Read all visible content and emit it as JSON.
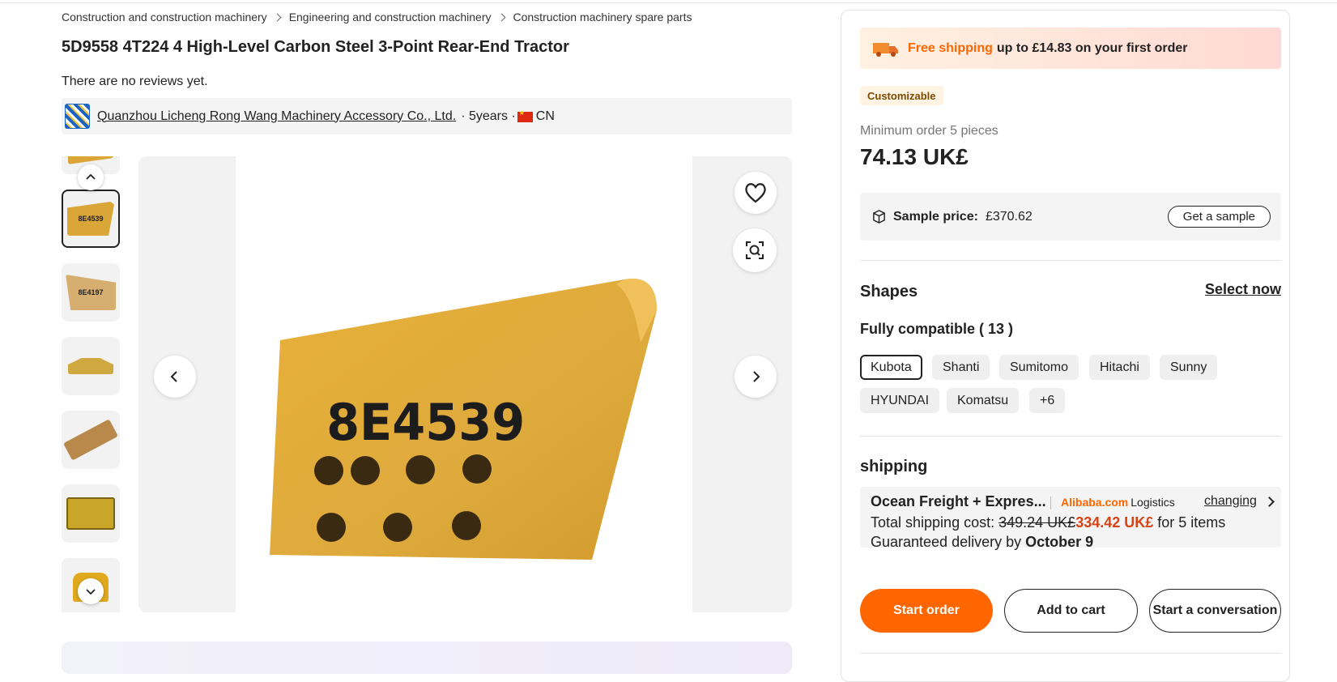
{
  "breadcrumb": [
    "Construction and construction machinery",
    "Engineering and construction machinery",
    "Construction machinery spare parts"
  ],
  "product": {
    "title": "5D9558 4T224 4 High-Level Carbon Steel 3-Point Rear-End Tractor",
    "reviews": "There are no reviews yet."
  },
  "supplier": {
    "name": "Quanzhou Licheng Rong Wang Machinery Accessory Co., Ltd.",
    "years": "· 5years ·",
    "country": "CN"
  },
  "gallery": {
    "main_image_code": "8E4539",
    "thumbnail_codes": [
      "8E4539",
      "8E4197"
    ]
  },
  "promo": {
    "highlight": "Free shipping",
    "rest": "up to £14.83 on your first order"
  },
  "badge": "Customizable",
  "pricing": {
    "min_order": "Minimum order 5 pieces",
    "price": "74.13 UK£",
    "sample_label": "Sample price:",
    "sample_value": "£370.62",
    "sample_button": "Get a sample"
  },
  "shapes": {
    "title": "Shapes",
    "select_now": "Select now",
    "compat": "Fully compatible ( 13 )",
    "chips": [
      "Kubota",
      "Shanti",
      "Sumitomo",
      "Hitachi",
      "Sunny",
      "HYUNDAI",
      "Komatsu",
      "+6"
    ],
    "selected": "Kubota"
  },
  "shipping": {
    "title": "shipping",
    "method": "Ocean Freight + Expres...",
    "logistics_brand": "Alibaba.com",
    "logistics_word": "Logistics",
    "change": "changing",
    "cost_prefix": "Total shipping cost:",
    "cost_old": "349.24 UK£",
    "cost_new": "334.42 UK£",
    "cost_suffix": "for 5 items",
    "delivery_prefix": "Guaranteed delivery by",
    "delivery_date": "October 9"
  },
  "actions": {
    "start_order": "Start order",
    "add_to_cart": "Add to cart",
    "conversation": "Start a conversation"
  },
  "colors": {
    "accent": "#ff6600",
    "discount_price": "#d84315"
  }
}
